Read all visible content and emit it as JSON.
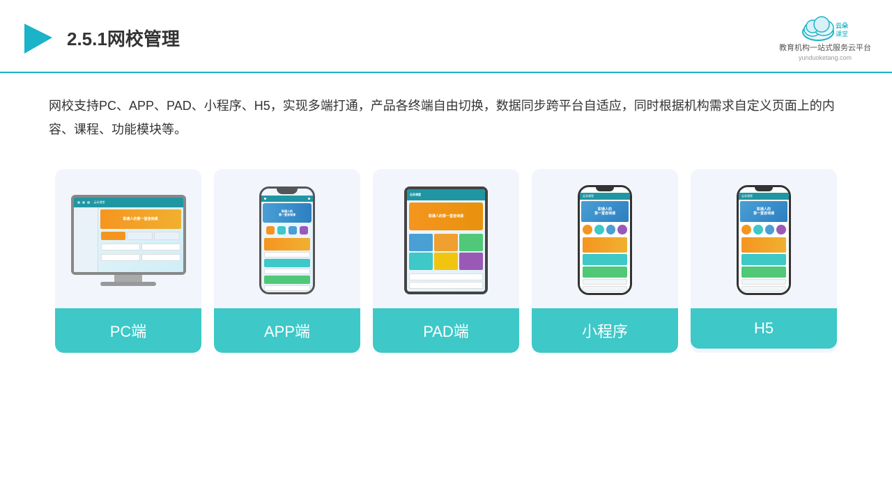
{
  "header": {
    "title": "2.5.1网校管理",
    "logo_name": "云朵课堂",
    "logo_sub": "教育机构一站\n式服务云平台",
    "logo_url": "yunduoketang.com"
  },
  "description": {
    "text": "网校支持PC、APP、PAD、小程序、H5，实现多端打通，产品各终端自由切换，数据同步跨平台自适应，同时根据机构需求自定义页面上的内容、课程、功能模块等。"
  },
  "cards": [
    {
      "id": "pc",
      "label": "PC端"
    },
    {
      "id": "app",
      "label": "APP端"
    },
    {
      "id": "pad",
      "label": "PAD端"
    },
    {
      "id": "miniprogram",
      "label": "小程序"
    },
    {
      "id": "h5",
      "label": "H5"
    }
  ],
  "colors": {
    "teal": "#3ec8c8",
    "accent_blue": "#1ab3c8",
    "dark_text": "#333333",
    "card_bg": "#f2f6fc"
  }
}
